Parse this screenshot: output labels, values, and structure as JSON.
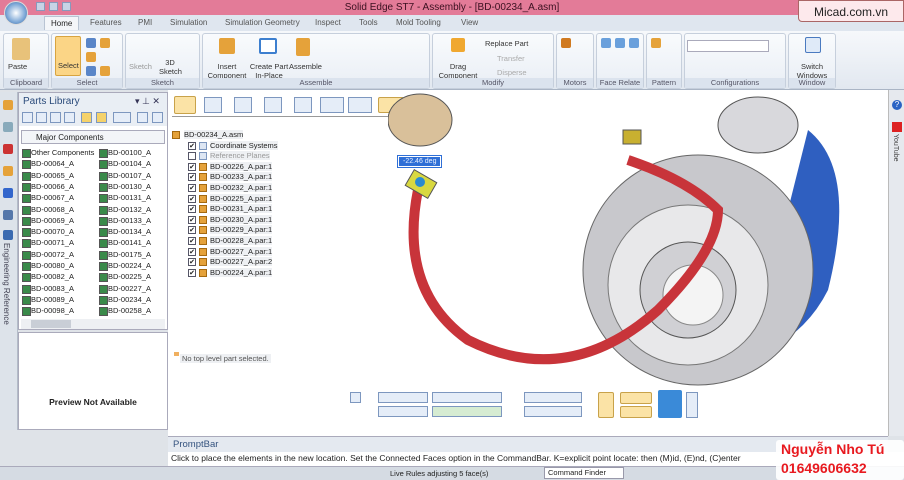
{
  "window": {
    "title": "Solid Edge ST7 - Assembly - [BD-00234_A.asm]",
    "watermark_site": "Micad.com.vn"
  },
  "tabs": [
    "Home",
    "Features",
    "PMI",
    "Simulation",
    "Simulation Geometry",
    "Inspect",
    "Tools",
    "Mold Tooling",
    "View"
  ],
  "ribbon": {
    "clipboard": {
      "label": "Clipboard",
      "paste": "Paste"
    },
    "select": {
      "label": "Select",
      "select": "Select"
    },
    "sketch": {
      "label": "Sketch",
      "sketch": "Sketch",
      "sketch3d": "3D Sketch"
    },
    "assemble": {
      "label": "Assemble",
      "insert": "Insert Component",
      "create": "Create Part In-Place",
      "assemble": "Assemble"
    },
    "modify": {
      "label": "Modify",
      "drag": "Drag Component",
      "replace": "Replace Part",
      "transfer": "Transfer",
      "disperse": "Disperse"
    },
    "motors": {
      "label": "Motors"
    },
    "face_relate": {
      "label": "Face Relate"
    },
    "pattern": {
      "label": "Pattern"
    },
    "configurations": {
      "label": "Configurations"
    },
    "window": {
      "label": "Window",
      "switch": "Switch Windows"
    }
  },
  "left_strip": {
    "vertical_label": "Engineering Reference"
  },
  "parts_library": {
    "title": "Parts Library",
    "folder": "Major Components",
    "col1": [
      "Other Components",
      "BD-00064_A",
      "BD-00065_A",
      "BD-00066_A",
      "BD-00067_A",
      "BD-00068_A",
      "BD-00069_A",
      "BD-00070_A",
      "BD-00071_A",
      "BD-00072_A",
      "BD-00080_A",
      "BD-00082_A",
      "BD-00083_A",
      "BD-00089_A",
      "BD-00098_A"
    ],
    "col2": [
      "BD-00100_A",
      "BD-00104_A",
      "BD-00107_A",
      "BD-00130_A",
      "BD-00131_A",
      "BD-00132_A",
      "BD-00133_A",
      "BD-00134_A",
      "BD-00141_A",
      "BD-00175_A",
      "BD-00224_A",
      "BD-00225_A",
      "BD-00227_A",
      "BD-00234_A",
      "BD-00258_A"
    ],
    "preview": "Preview Not Available"
  },
  "tree": {
    "root": "BD-00234_A.asm",
    "items": [
      {
        "label": "Coordinate Systems",
        "checked": true
      },
      {
        "label": "Reference Planes",
        "checked": false
      },
      {
        "label": "BD-00226_A.par:1",
        "checked": true
      },
      {
        "label": "BD-00233_A.par:1",
        "checked": true
      },
      {
        "label": "BD-00232_A.par:1",
        "checked": true
      },
      {
        "label": "BD-00225_A.par:1",
        "checked": true
      },
      {
        "label": "BD-00231_A.par:1",
        "checked": true
      },
      {
        "label": "BD-00230_A.par:1",
        "checked": true
      },
      {
        "label": "BD-00229_A.par:1",
        "checked": true
      },
      {
        "label": "BD-00228_A.par:1",
        "checked": true
      },
      {
        "label": "BD-00227_A.par:1",
        "checked": true
      },
      {
        "label": "BD-00227_A.par:2",
        "checked": true
      },
      {
        "label": "BD-00224_A.par:1",
        "checked": true
      }
    ],
    "status": "No top level part selected."
  },
  "viewport": {
    "angle_readout": "-22.46 deg"
  },
  "right_strip": {
    "youtube": "YouTube"
  },
  "promptbar": {
    "title": "PromptBar",
    "message": "Click to place the elements in the new location.  Set the Connected Faces option in the CommandBar.  K=explicit point locate: then (M)id, (E)nd, (C)enter"
  },
  "statusbar": {
    "live_rules": "Live Rules adjusting 5 face(s)",
    "command_finder": "Command Finder"
  },
  "watermark": {
    "name": "Nguyễn Nho Tú",
    "phone": "01649606632"
  }
}
